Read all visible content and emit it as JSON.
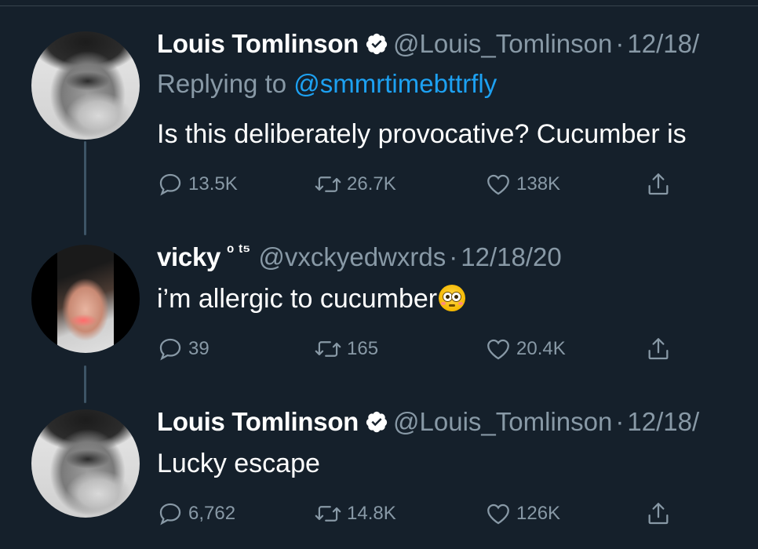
{
  "thread": [
    {
      "name": "Louis Tomlinson",
      "verified": true,
      "handle": "@Louis_Tomlinson",
      "date_sep": "·",
      "date": "12/18/",
      "replying_prefix": "Replying to ",
      "replying_handle": "@smmrtimebttrfly",
      "text": "Is this deliberately provocative? Cucumber is",
      "stats": {
        "replies": "13.5K",
        "retweets": "26.7K",
        "likes": "138K"
      }
    },
    {
      "name": "vicky",
      "name_suffix": "ᵒ ᵗ⁵",
      "handle": "@vxckyedwxrds",
      "date_sep": "·",
      "date": "12/18/20",
      "text": "i’m allergic to cucumber",
      "emoji": "flushed-face",
      "stats": {
        "replies": "39",
        "retweets": "165",
        "likes": "20.4K"
      }
    },
    {
      "name": "Louis Tomlinson",
      "verified": true,
      "handle": "@Louis_Tomlinson",
      "date_sep": "·",
      "date": "12/18/",
      "text": "Lucky escape",
      "stats": {
        "replies": "6,762",
        "retweets": "14.8K",
        "likes": "126K"
      }
    }
  ],
  "colors": {
    "background": "#15202b",
    "secondary_text": "#8899a6",
    "link": "#1da1f2",
    "thread_line": "#3d5466"
  }
}
